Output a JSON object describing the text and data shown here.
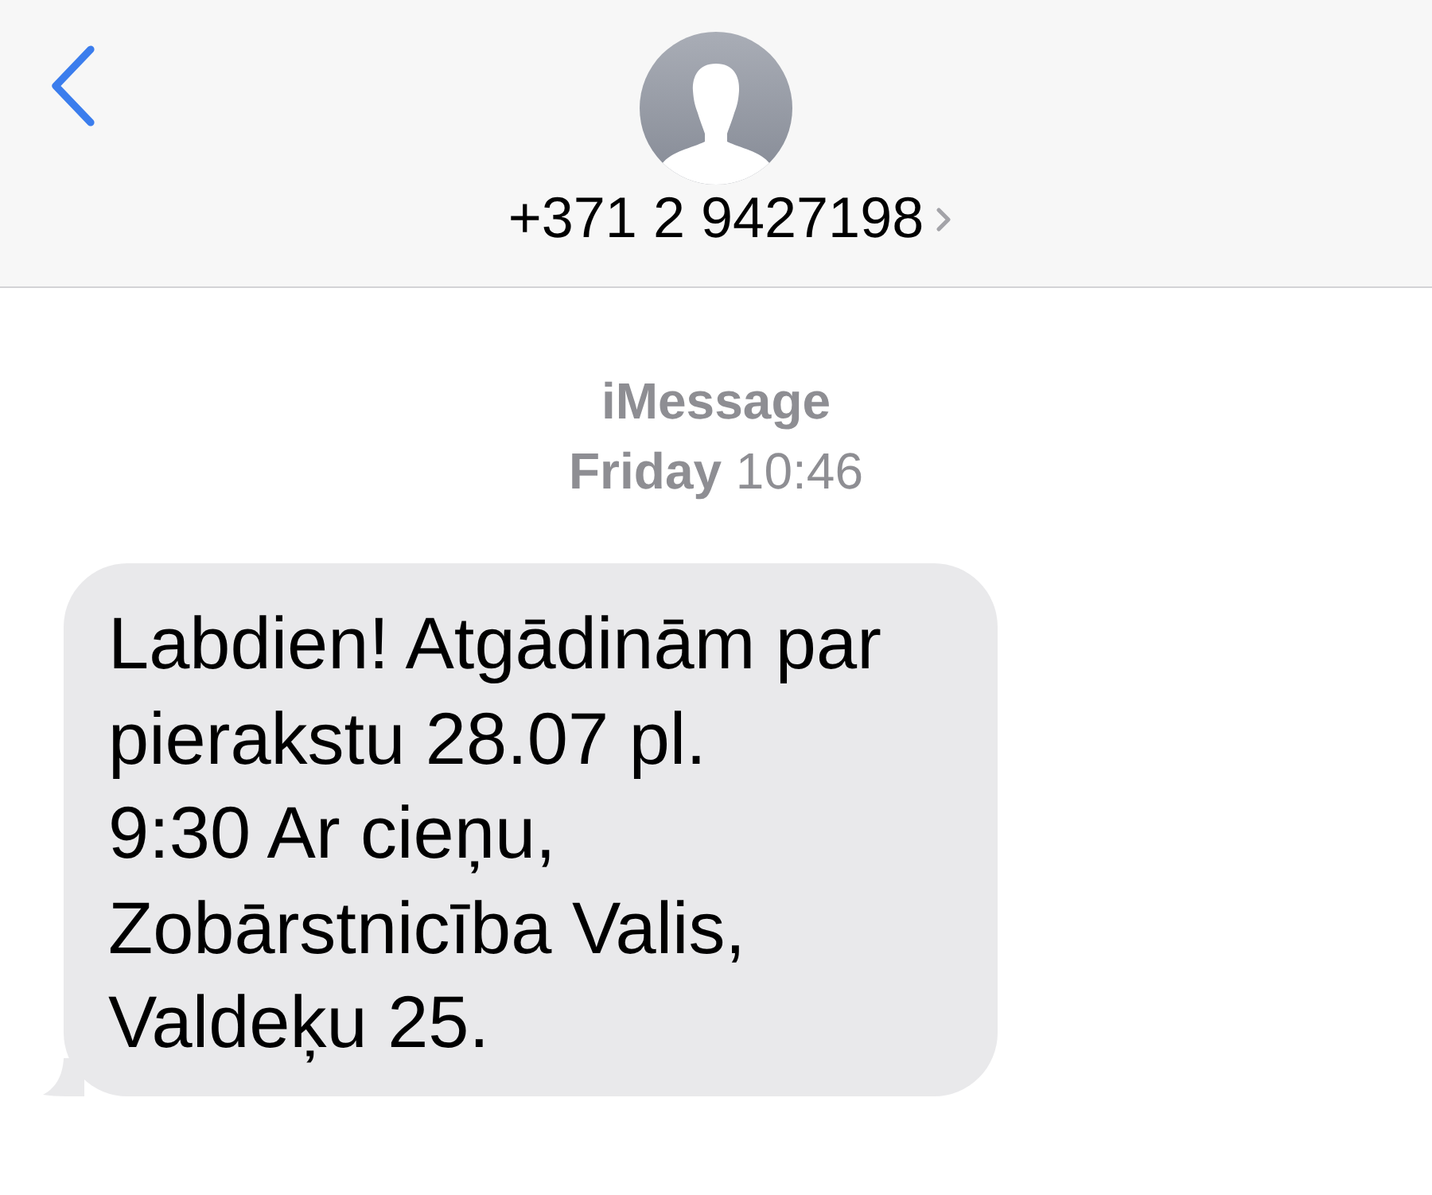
{
  "header": {
    "contact": {
      "phone": "+371 2 9427198"
    }
  },
  "conversation": {
    "service": "iMessage",
    "timestamp": "**Friday** 10:46",
    "messages": [
      {
        "kind": "received",
        "text": "Labdien! Atgādinām par\npierakstu 28.07 pl.\n9:30 Ar cieņu,\nZobārstnicība Valis,\nValdeķu 25."
      }
    ]
  }
}
